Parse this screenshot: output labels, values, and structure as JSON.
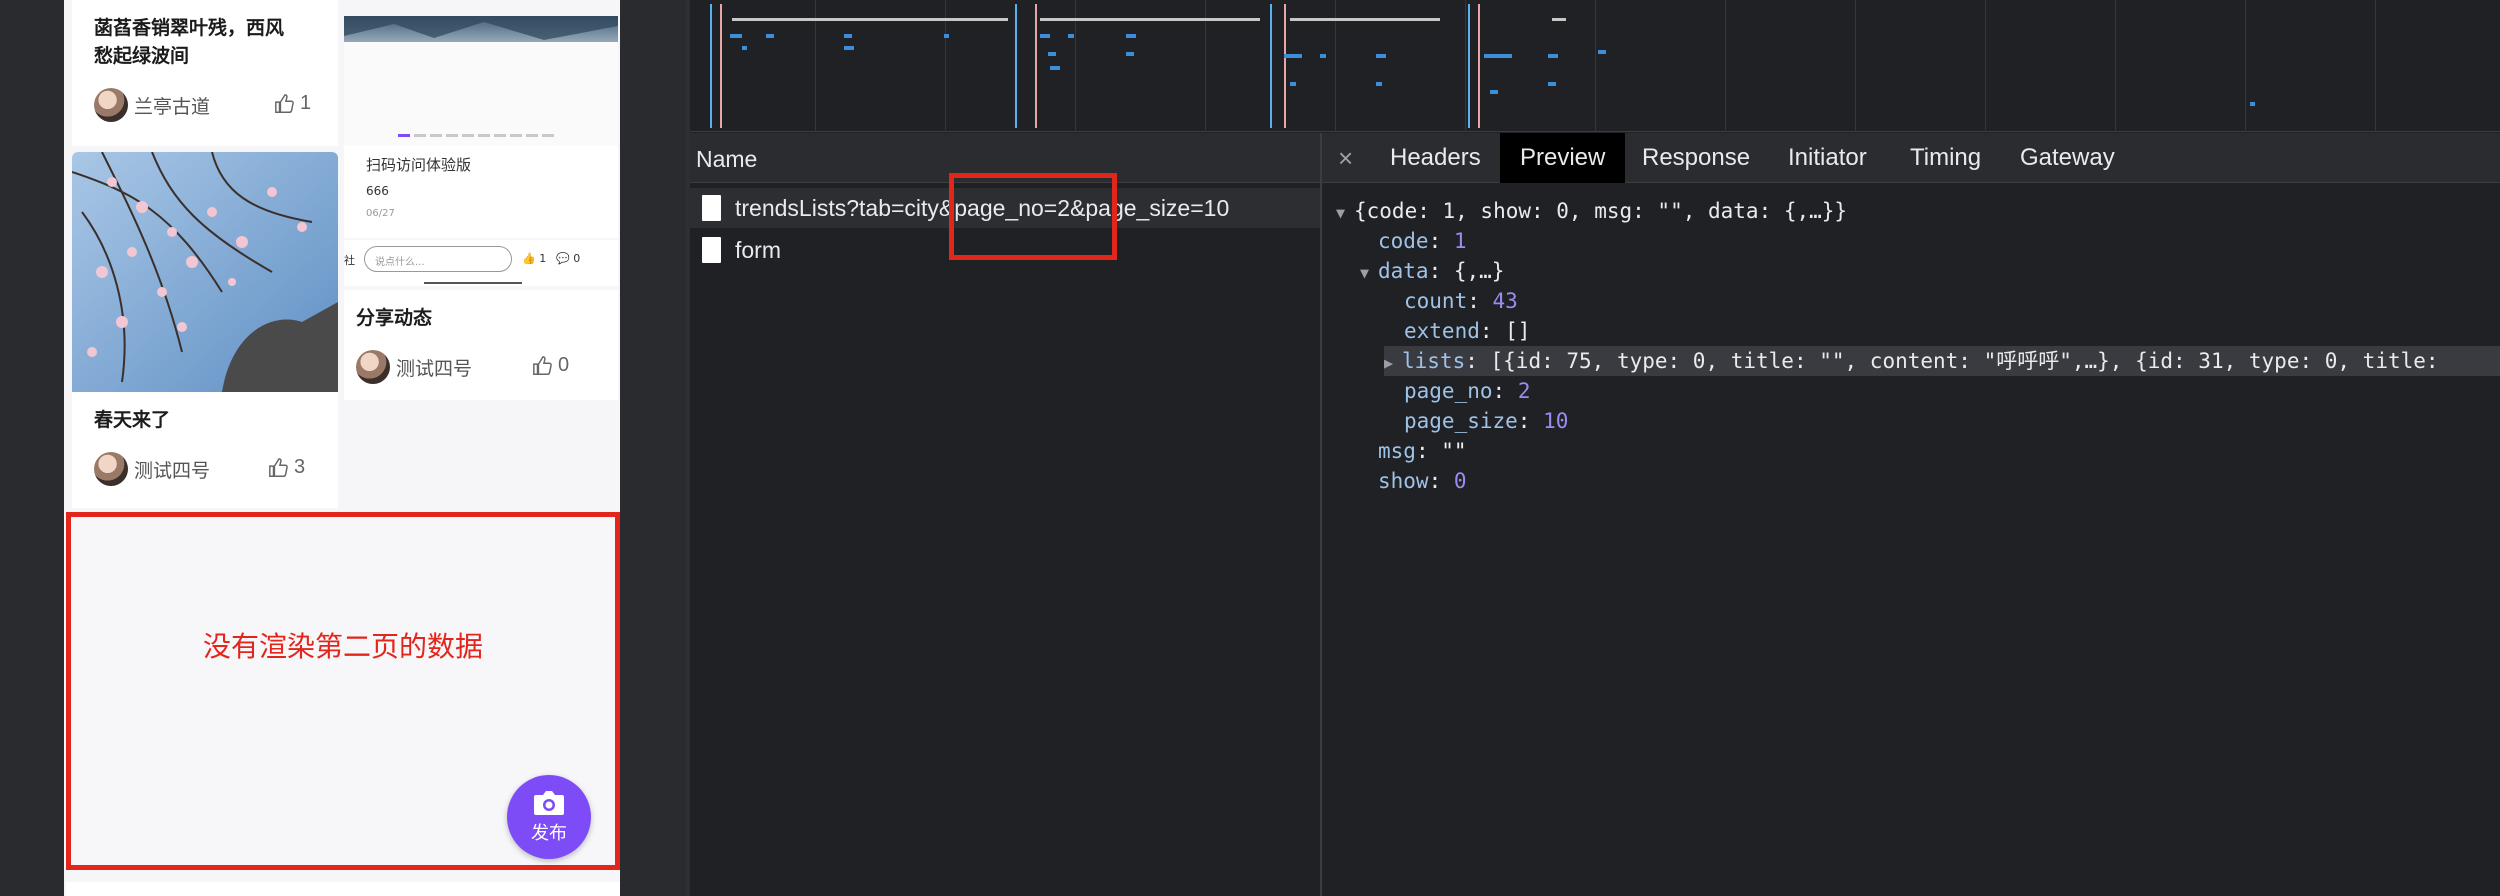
{
  "mobile": {
    "cards": [
      {
        "title_line1": "菡萏香销翠叶残，西风",
        "title_line2": "愁起绿波间",
        "author": "兰亭古道",
        "likes": "1"
      },
      {
        "title": "春天来了",
        "author": "测试四号",
        "likes": "3"
      },
      {
        "title": "分享动态",
        "author": "测试四号",
        "likes": "0"
      }
    ],
    "mini_screenshot": {
      "title": "扫码访问体验版",
      "number": "666",
      "date": "06/27",
      "comment_placeholder": "说点什么...",
      "like_count": "1",
      "comment_count": "0",
      "edge_char": "社"
    },
    "annotation": "没有渲染第二页的数据",
    "publish_label": "发布",
    "colors": {
      "annotation": "#e2261c",
      "publish": "#7d4cf6"
    }
  },
  "devtools": {
    "requests_header": "Name",
    "requests": [
      {
        "name": "trendsLists?tab=city&page_no=2&page_size=10",
        "selected": true
      },
      {
        "name": "form",
        "selected": false
      }
    ],
    "tabs": [
      "Headers",
      "Preview",
      "Response",
      "Initiator",
      "Timing",
      "Gateway"
    ],
    "active_tab": "Preview",
    "close_icon": "×",
    "preview": {
      "root": "{code: 1, show: 0, msg: \"\", data: {,…}}",
      "code_key": "code",
      "code_val": "1",
      "data_key": "data",
      "data_val": "{,…}",
      "count_key": "count",
      "count_val": "43",
      "extend_key": "extend",
      "extend_val": "[]",
      "lists_key": "lists",
      "lists_val": "[{id: 75, type: 0, title: \"\", content: \"呼呼呼\",…}, {id: 31, type: 0, title:",
      "page_no_key": "page_no",
      "page_no_val": "2",
      "page_size_key": "page_size",
      "page_size_val": "10",
      "msg_key": "msg",
      "msg_val": "\"\"",
      "show_key": "show",
      "show_val": "0"
    }
  }
}
